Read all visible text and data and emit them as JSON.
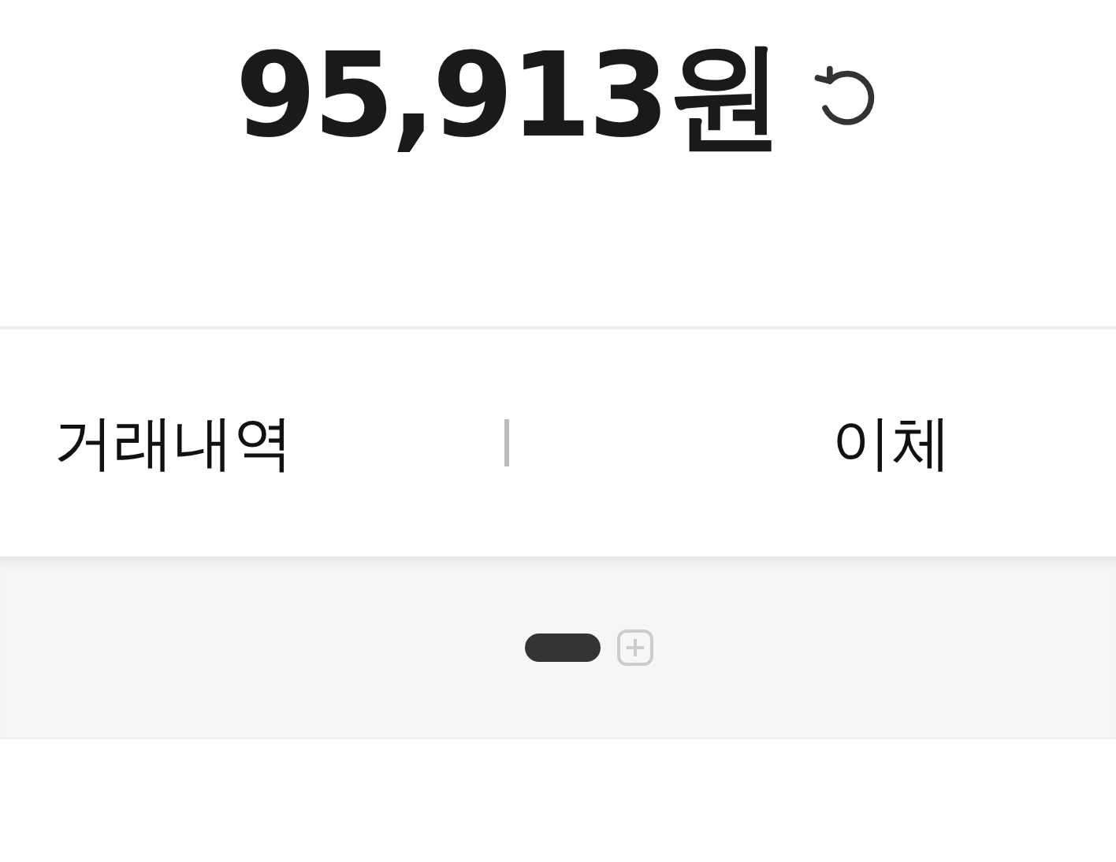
{
  "balance": {
    "amount": "95,913원"
  },
  "actions": [
    {
      "label": "거래내역"
    },
    {
      "label": "이체"
    }
  ],
  "pages": [
    {
      "selected": true
    }
  ]
}
